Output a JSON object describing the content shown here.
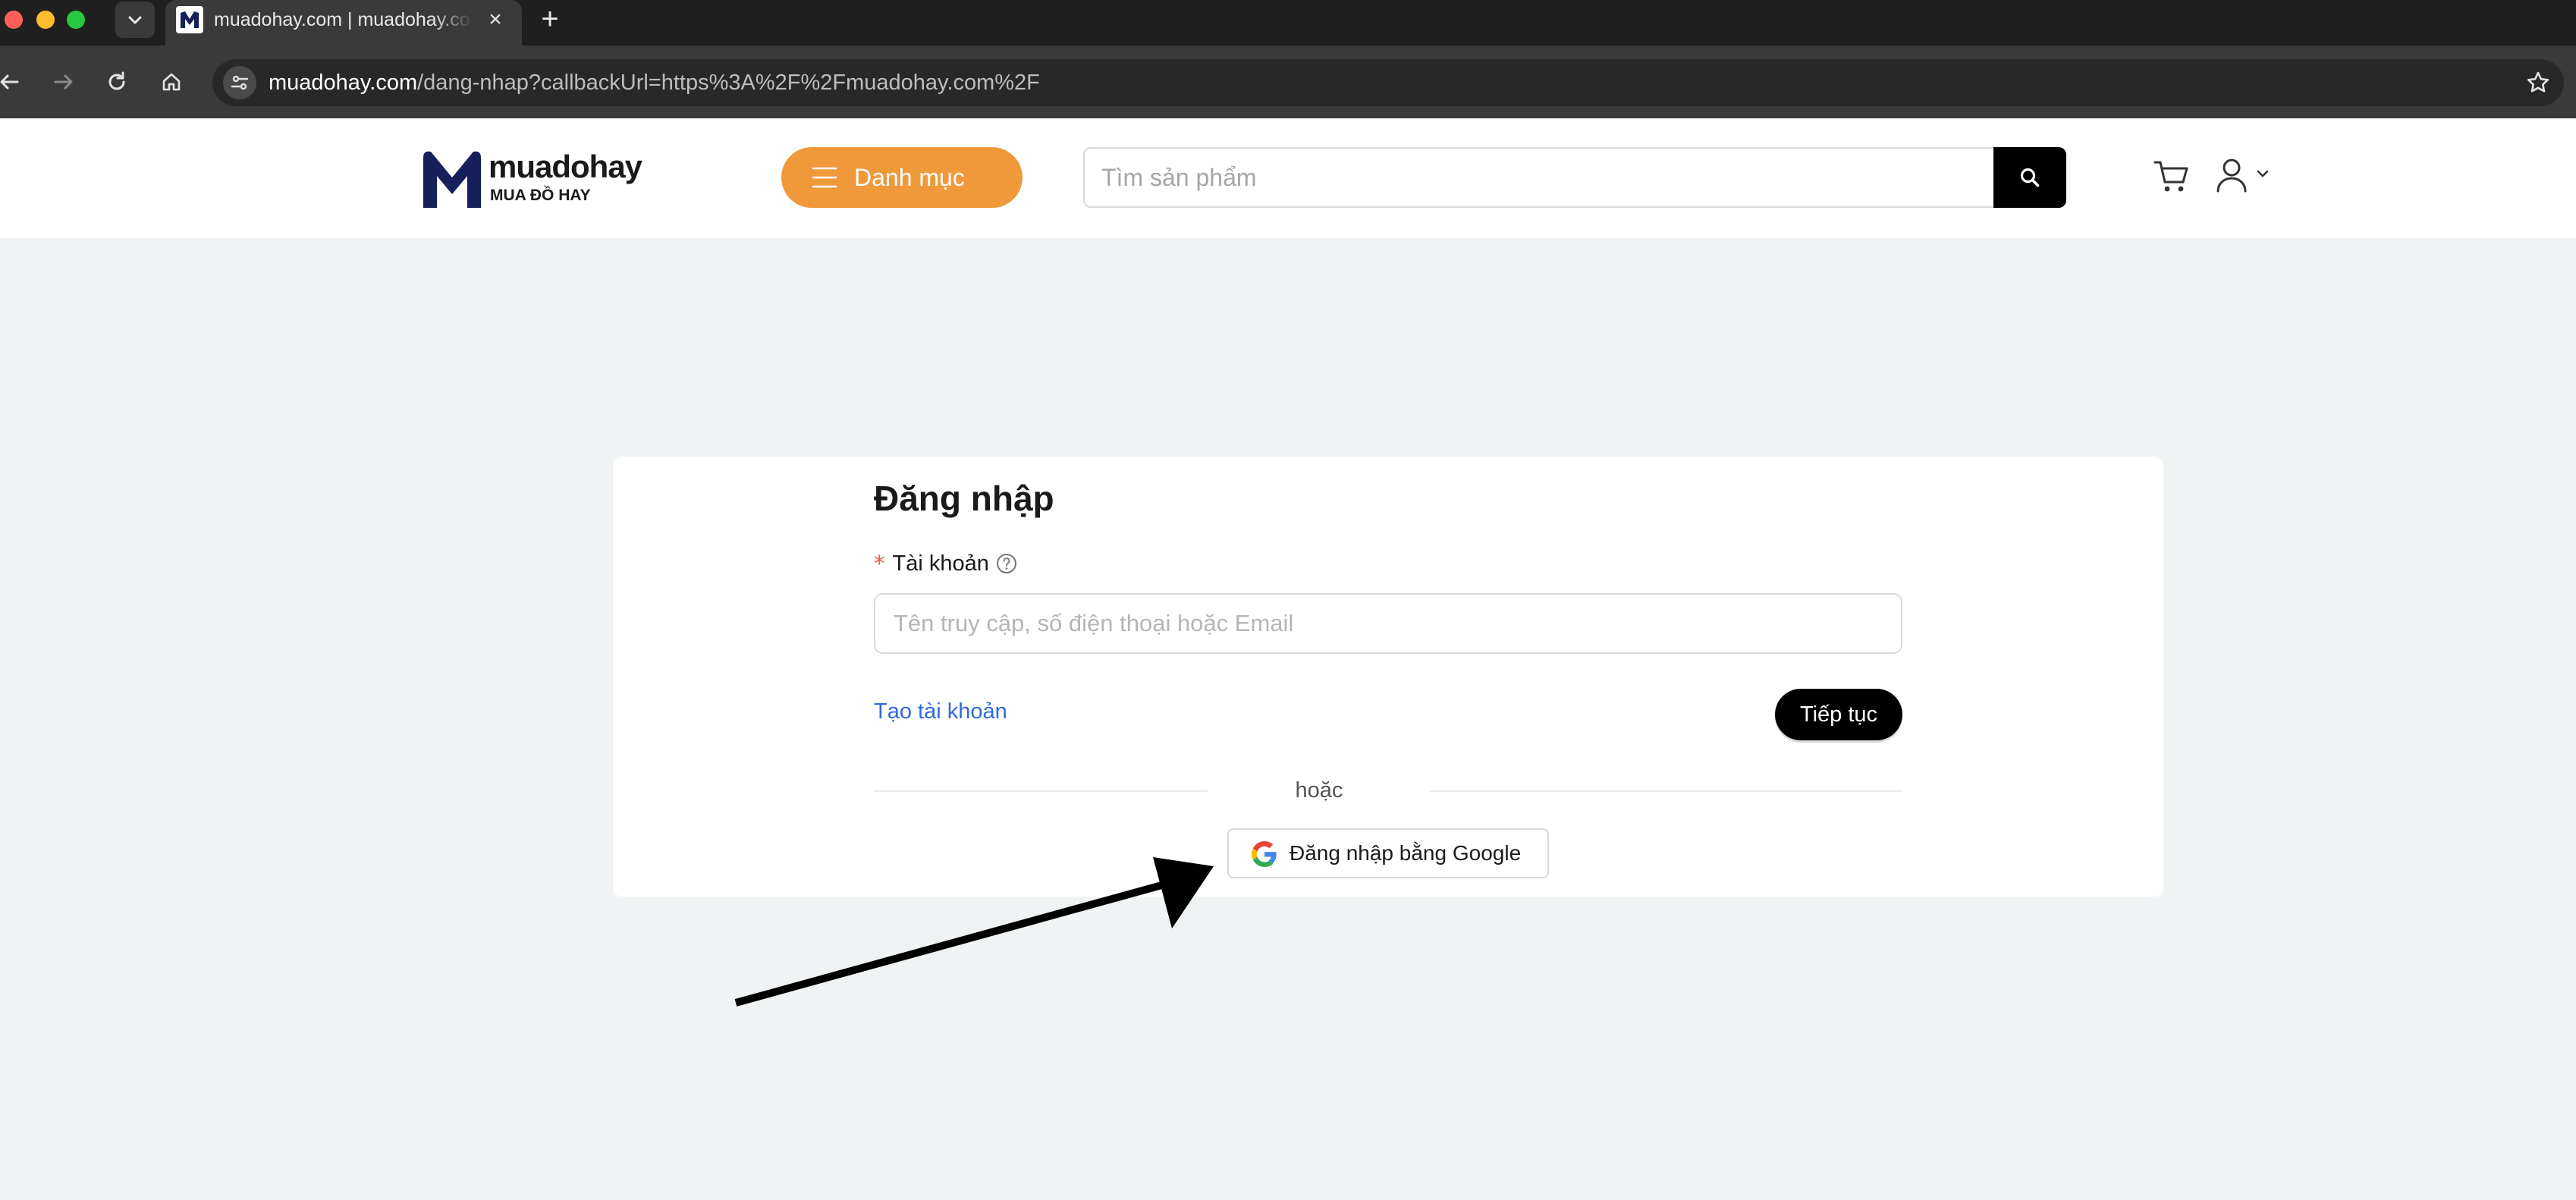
{
  "browser": {
    "tab": {
      "title": "muadohay.com | muadohay.com",
      "close_icon": "×",
      "favicon": "muadohay-m-logo"
    },
    "new_tab_icon": "+",
    "url_host": "muadohay.com",
    "url_path": "/dang-nhap?callbackUrl=https%3A%2F%2Fmuadohay.com%2F",
    "icons": [
      "tab-search-chevron-icon",
      "back-arrow-icon",
      "forward-arrow-icon",
      "reload-icon",
      "home-icon",
      "site-info-icon",
      "bookmark-star-icon"
    ]
  },
  "header": {
    "logo_name": "muadohay",
    "logo_tagline": "MUA ĐỒ HAY",
    "menu_label": "Danh mục",
    "search_placeholder": "Tìm sản phẩm",
    "colors": {
      "menu_button": "#f0993b",
      "search_button": "#000000"
    }
  },
  "login": {
    "title": "Đăng nhập",
    "required_mark": "*",
    "account_label": "Tài khoản",
    "account_placeholder": "Tên truy cập, số điện thoại hoặc Email",
    "create_account": "Tạo tài khoản",
    "continue_label": "Tiếp tục",
    "divider_text": "hoặc",
    "google_button": "Đăng nhập bằng Google",
    "colors": {
      "link": "#2f6bd8",
      "required": "#ff4d4f"
    }
  }
}
